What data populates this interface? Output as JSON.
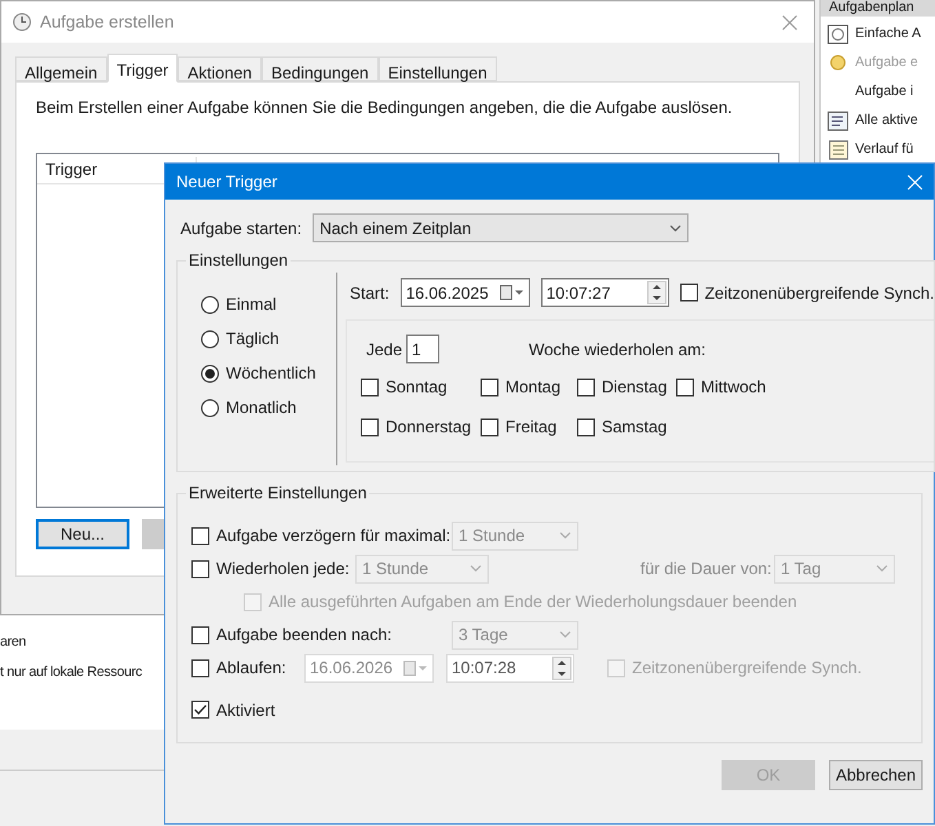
{
  "main_window": {
    "title": "Aufgabe erstellen",
    "tabs": [
      {
        "label": "Allgemein",
        "selected": false
      },
      {
        "label": "Trigger",
        "selected": true
      },
      {
        "label": "Aktionen",
        "selected": false
      },
      {
        "label": "Bedingungen",
        "selected": false
      },
      {
        "label": "Einstellungen",
        "selected": false
      }
    ],
    "description": "Beim Erstellen einer Aufgabe können Sie die Bedingungen angeben, die die Aufgabe auslösen.",
    "trigger_list": {
      "columns": [
        "Trigger"
      ]
    },
    "buttons": [
      "Neu..."
    ]
  },
  "side_panel": {
    "header": "Aufgabenplan",
    "items": [
      {
        "label": "Einfache A",
        "kind": "calendar",
        "disabled": false
      },
      {
        "label": "Aufgabe e",
        "kind": "sun",
        "disabled": true
      },
      {
        "label": "Aufgabe i",
        "kind": "none",
        "disabled": false
      },
      {
        "label": "Alle aktive",
        "kind": "list",
        "disabled": false
      },
      {
        "label": "Verlauf fü",
        "kind": "log",
        "disabled": false
      }
    ]
  },
  "back_window": {
    "lines": [
      "aren",
      "t nur auf lokale Ressourc"
    ]
  },
  "dialog": {
    "title": "Neuer Trigger",
    "start": {
      "label": "Aufgabe starten:",
      "value": "Nach einem Zeitplan"
    },
    "settings": {
      "title": "Einstellungen",
      "schedules": [
        {
          "label": "Einmal",
          "selected": false
        },
        {
          "label": "Täglich",
          "selected": false
        },
        {
          "label": "Wöchentlich",
          "selected": true
        },
        {
          "label": "Monatlich",
          "selected": false
        }
      ],
      "start_label": "Start:",
      "start_date": "16.06.2025",
      "start_time": "10:07:27",
      "sync": {
        "label": "Zeitzonenübergreifende Synch.",
        "checked": false
      },
      "every_label": "Jede",
      "every_value": "1",
      "weeks_label": "Woche wiederholen am:",
      "days": [
        {
          "label": "Sonntag",
          "checked": false
        },
        {
          "label": "Montag",
          "checked": false
        },
        {
          "label": "Dienstag",
          "checked": false
        },
        {
          "label": "Mittwoch",
          "checked": false
        },
        {
          "label": "Donnerstag",
          "checked": false
        },
        {
          "label": "Freitag",
          "checked": false
        },
        {
          "label": "Samstag",
          "checked": false
        }
      ]
    },
    "advanced": {
      "title": "Erweiterte Einstellungen",
      "delay": {
        "label": "Aufgabe verzögern für maximal:",
        "checked": false,
        "value": "1 Stunde"
      },
      "repeat": {
        "label": "Wiederholen jede:",
        "checked": false,
        "value": "1 Stunde",
        "duration_label": "für die Dauer von:",
        "duration_value": "1 Tag"
      },
      "stop_all": {
        "label": "Alle ausgeführten Aufgaben am Ende der Wiederholungsdauer beenden",
        "checked": false,
        "disabled": true
      },
      "end_after": {
        "label": "Aufgabe beenden nach:",
        "checked": false,
        "value": "3 Tage"
      },
      "expire": {
        "label": "Ablaufen:",
        "checked": false,
        "date": "16.06.2026",
        "time": "10:07:28",
        "sync": {
          "label": "Zeitzonenübergreifende Synch.",
          "checked": false,
          "disabled": true
        }
      },
      "enabled": {
        "label": "Aktiviert",
        "checked": true
      }
    },
    "buttons": [
      {
        "label": "OK",
        "disabled": true
      },
      {
        "label": "Abbrechen",
        "disabled": false
      }
    ]
  }
}
